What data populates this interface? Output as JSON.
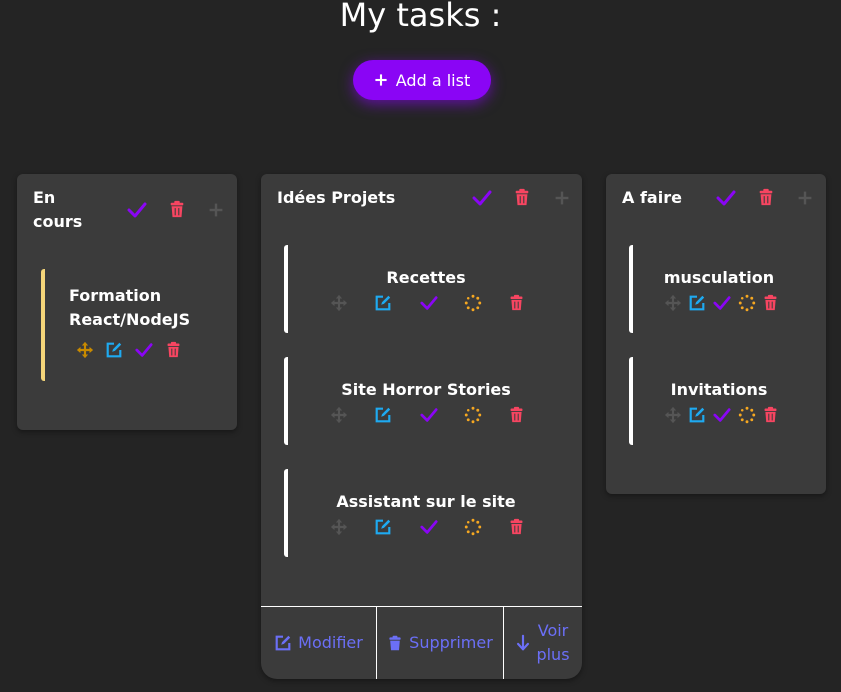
{
  "page": {
    "title": "My tasks :"
  },
  "add_button": {
    "label": "Add a list"
  },
  "lists": [
    {
      "title_line1": "En",
      "title_line2": "cours",
      "cards": [
        {
          "title_line1": "Formation",
          "title_line2": "React/NodeJS"
        }
      ]
    },
    {
      "title": "Idées Projets",
      "cards": [
        {
          "title": "Recettes"
        },
        {
          "title": "Site Horror Stories"
        },
        {
          "title": "Assistant sur le site"
        }
      ],
      "footer": {
        "edit_label": "Modifier",
        "delete_label": "Supprimer",
        "more_line1": "Voir",
        "more_line2": "plus"
      }
    },
    {
      "title": "A faire",
      "cards": [
        {
          "title": "musculation"
        },
        {
          "title": "Invitations"
        }
      ]
    }
  ],
  "colors": {
    "accent": "#8a05f5",
    "edit": "#1eaaf1",
    "done": "#8a05f5",
    "pending": "#f6a821",
    "delete": "#f74561",
    "move": "#555555",
    "move_active": "#c88a00",
    "card_border_active": "#f5d67a",
    "link": "#6b6ff6"
  }
}
